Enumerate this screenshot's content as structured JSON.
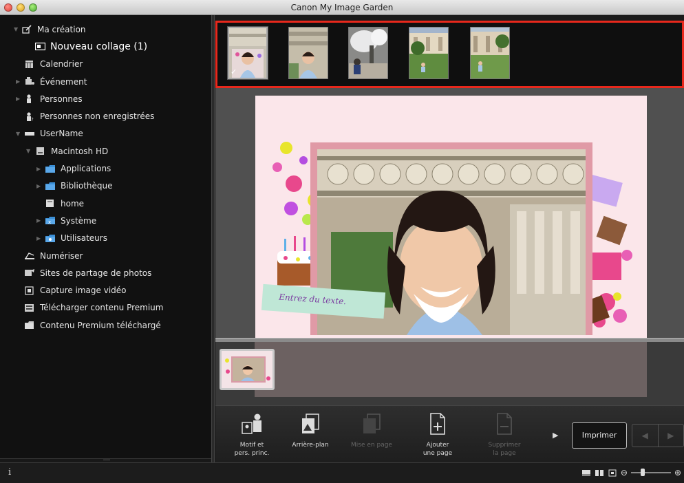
{
  "window": {
    "title": "Canon My Image Garden"
  },
  "sidebar": {
    "items": [
      {
        "label": "Ma création",
        "icon": "creation-icon",
        "expanded": true
      },
      {
        "label": "Nouveau collage (1)",
        "icon": "collage-icon",
        "selected": true
      },
      {
        "label": "Calendrier",
        "icon": "calendar-icon"
      },
      {
        "label": "Événement",
        "icon": "event-icon",
        "expanded": false
      },
      {
        "label": "Personnes",
        "icon": "person-icon",
        "expanded": false
      },
      {
        "label": "Personnes non enregistrées",
        "icon": "unregistered-person-icon"
      },
      {
        "label": "UserName",
        "icon": "user-drive-icon",
        "expanded": true
      },
      {
        "label": "Macintosh HD",
        "icon": "hard-disk-icon",
        "expanded": true
      },
      {
        "label": "Applications",
        "icon": "folder-icon",
        "expanded": false
      },
      {
        "label": "Bibliothèque",
        "icon": "folder-icon",
        "expanded": false
      },
      {
        "label": "home",
        "icon": "home-folder-icon"
      },
      {
        "label": "Système",
        "icon": "system-folder-icon",
        "expanded": false
      },
      {
        "label": "Utilisateurs",
        "icon": "users-folder-icon",
        "expanded": false
      },
      {
        "label": "Numériser",
        "icon": "scan-icon"
      },
      {
        "label": "Sites de partage de photos",
        "icon": "photo-sharing-icon"
      },
      {
        "label": "Capture image vidéo",
        "icon": "video-capture-icon"
      },
      {
        "label": "Télécharger contenu Premium",
        "icon": "download-premium-icon"
      },
      {
        "label": "Contenu Premium téléchargé",
        "icon": "premium-folder-icon"
      }
    ]
  },
  "image_strip": {
    "thumbnails": [
      {
        "name": "photo-thumb-1",
        "selected": true
      },
      {
        "name": "photo-thumb-2",
        "selected": false
      },
      {
        "name": "photo-thumb-3",
        "selected": false
      },
      {
        "name": "photo-thumb-4",
        "selected": false
      },
      {
        "name": "photo-thumb-5",
        "selected": false
      }
    ],
    "highlight_color": "#e8281c"
  },
  "canvas": {
    "text_placeholder": "Entrez du texte."
  },
  "toolbar": {
    "motif_label": [
      "Motif et",
      "pers. princ."
    ],
    "background_label": [
      "Arrière-plan"
    ],
    "layout_label": [
      "Mise en page"
    ],
    "add_page_label": [
      "Ajouter",
      "une page"
    ],
    "delete_page_label": [
      "Supprimer",
      "la page"
    ],
    "print_label": "Imprimer"
  },
  "statusbar": {
    "info_label": "i"
  }
}
